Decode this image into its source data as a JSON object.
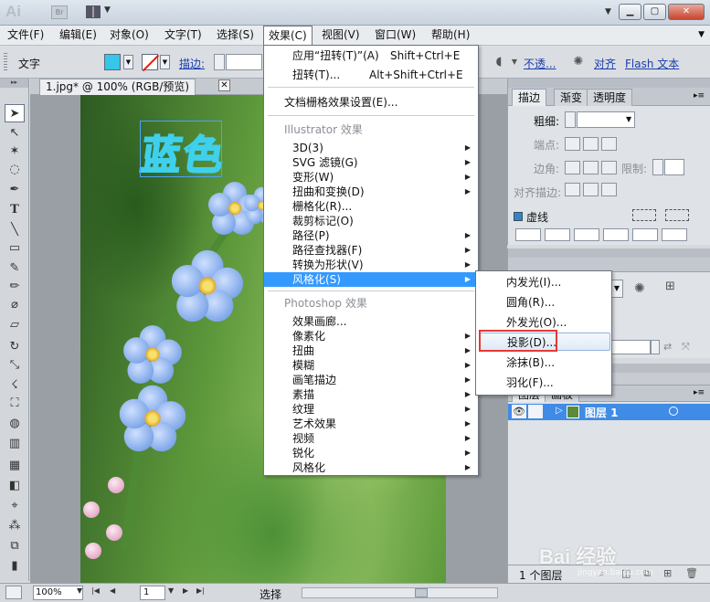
{
  "titlebar": {
    "logo": "Ai",
    "bridge": "Br"
  },
  "menubar": {
    "items": [
      "文件(F)",
      "编辑(E)",
      "对象(O)",
      "文字(T)",
      "选择(S)",
      "效果(C)",
      "视图(V)",
      "窗口(W)",
      "帮助(H)"
    ]
  },
  "controlbar": {
    "mode_label": "文字",
    "stroke_label": "描边:",
    "opacity_link": "不透...",
    "align_link": "对齐",
    "flash_link": "Flash 文本",
    "fill_color": "#35c6e8"
  },
  "document": {
    "tab_title": "1.jpg* @ 100% (RGB/预览)",
    "art_text": "蓝色"
  },
  "effect_menu": {
    "apply_label": "应用“扭转(T)”(A)",
    "apply_shortcut": "Shift+Ctrl+E",
    "twist_label": "扭转(T)...",
    "twist_shortcut": "Alt+Shift+Ctrl+E",
    "raster_settings": "文档栅格效果设置(E)...",
    "illustrator_header": "Illustrator 效果",
    "illustrator_items": [
      "3D(3)",
      "SVG 滤镜(G)",
      "变形(W)",
      "扭曲和变换(D)",
      "栅格化(R)...",
      "裁剪标记(O)",
      "路径(P)",
      "路径查找器(F)",
      "转换为形状(V)",
      "风格化(S)"
    ],
    "photoshop_header": "Photoshop 效果",
    "photoshop_items": [
      "效果画廊...",
      "像素化",
      "扭曲",
      "模糊",
      "画笔描边",
      "素描",
      "纹理",
      "艺术效果",
      "视频",
      "锐化",
      "风格化"
    ]
  },
  "stylize_submenu": {
    "items": [
      "内发光(I)...",
      "圆角(R)...",
      "外发光(O)...",
      "投影(D)...",
      "涂抹(B)...",
      "羽化(F)..."
    ],
    "selected": "投影(D)..."
  },
  "stroke_panel": {
    "tabs": [
      "描边",
      "渐变",
      "透明度"
    ],
    "weight_label": "粗细:",
    "cap_label": "端点:",
    "corner_label": "边角:",
    "limit_label": "限制:",
    "align_label": "对齐描边:",
    "dashed_label": "虚线"
  },
  "layers_panel": {
    "tabs": [
      "图层",
      "画板"
    ],
    "layer_name": "图层 1",
    "footer": "1 个图层"
  },
  "statusbar": {
    "zoom": "100%",
    "page": "1",
    "status_text": "选择"
  },
  "watermark": {
    "brand": "Bai 经验",
    "url": "jingyan.baidu.com"
  }
}
